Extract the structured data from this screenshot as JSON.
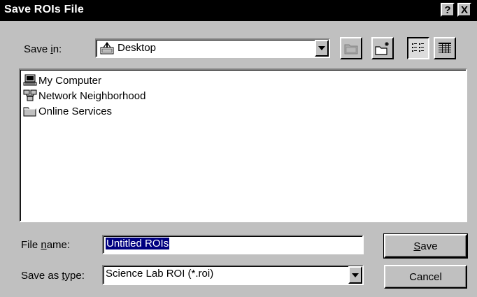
{
  "dialog": {
    "title": "Save ROIs File",
    "help_label": "?",
    "close_label": "X"
  },
  "save_in": {
    "label_pre": "Save ",
    "label_key": "i",
    "label_post": "n:",
    "value": "Desktop"
  },
  "toolbar": {
    "up_folder": "up-one-level-icon",
    "new_folder": "new-folder-icon",
    "list_view": "list-view-icon",
    "details_view": "details-view-icon"
  },
  "files": [
    {
      "label": "My Computer",
      "icon": "my-computer-icon"
    },
    {
      "label": "Network Neighborhood",
      "icon": "network-neighborhood-icon"
    },
    {
      "label": "Online Services",
      "icon": "folder-icon"
    }
  ],
  "file_name": {
    "label_pre": "File ",
    "label_key": "n",
    "label_post": "ame:",
    "value": "Untitled ROIs"
  },
  "save_as_type": {
    "label_pre": "Save as ",
    "label_key": "t",
    "label_post": "ype:",
    "value": "Science Lab ROI (*.roi)"
  },
  "buttons": {
    "save_key": "S",
    "save_rest": "ave",
    "cancel": "Cancel"
  },
  "colors": {
    "face": "#c0c0c0",
    "titlebar": "#000000",
    "selection": "#000080"
  }
}
